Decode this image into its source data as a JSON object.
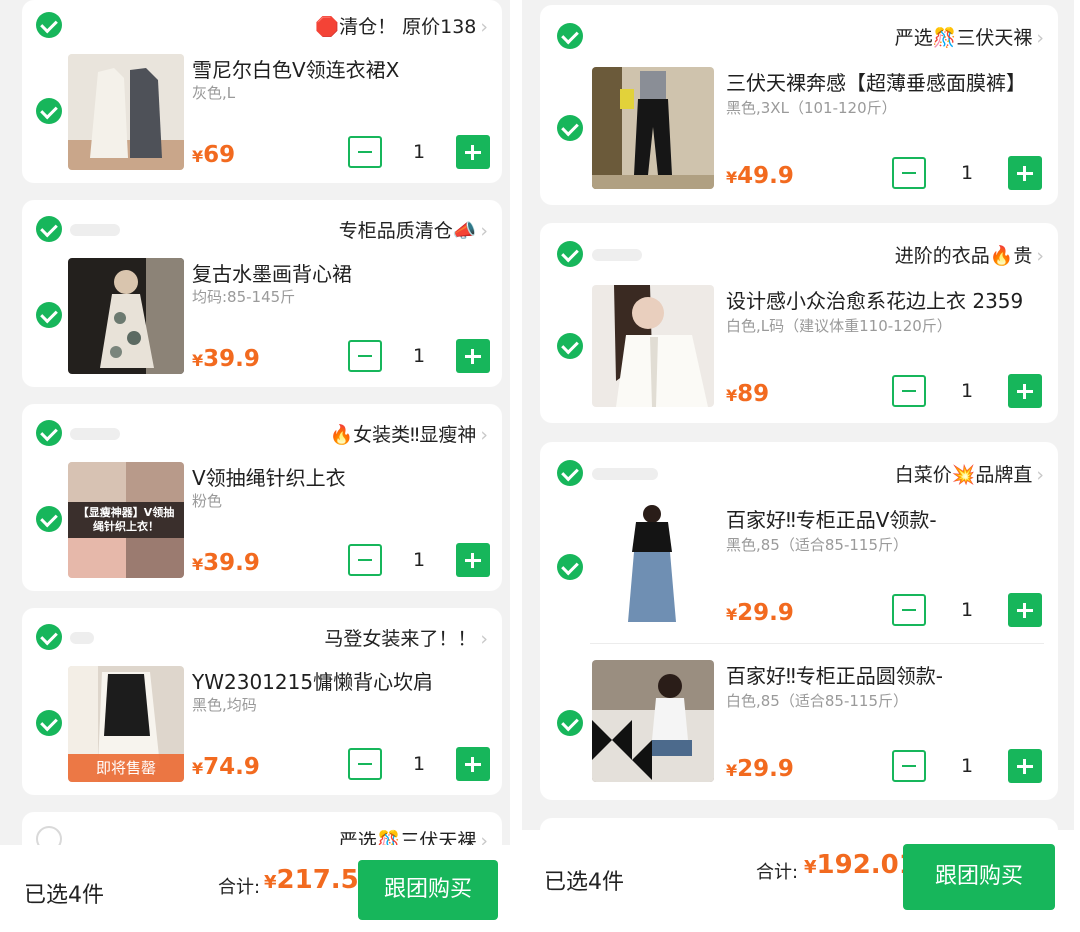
{
  "left": {
    "items": [
      {
        "shop": "🛑清仓！ 原价138",
        "title": "雪尼尔白色V领连衣裙X",
        "spec": "灰色,L",
        "price": "69",
        "qty": "1"
      },
      {
        "shop": "专柜品质清仓📣",
        "title": "复古水墨画背心裙",
        "spec": "均码:85-145斤",
        "price": "39.9",
        "qty": "1"
      },
      {
        "shop": "🔥女装类‼显瘦神",
        "title": "V领抽绳针织上衣",
        "spec": "粉色",
        "price": "39.9",
        "qty": "1",
        "thumb_text": "【显瘦神器】V领抽绳针织上衣！"
      },
      {
        "shop": "马登女装来了！！",
        "title": "YW2301215慵懒背心坎肩",
        "spec": "黑色,均码",
        "price": "74.9",
        "qty": "1",
        "badge": "即将售罄"
      }
    ],
    "peek_shop": "严选🎊三伏天裸",
    "footer": {
      "selected": "已选4件",
      "total_label": "合计:",
      "total": "217.57",
      "buy": "跟团购买"
    }
  },
  "right": {
    "shops": [
      {
        "shop": "严选🎊三伏天裸",
        "items": [
          {
            "title": "三伏天裸奔感【超薄垂感面膜裤】",
            "spec": "黑色,3XL（101-120斤）",
            "price": "49.9",
            "qty": "1"
          }
        ]
      },
      {
        "shop": "进阶的衣品🔥贵",
        "items": [
          {
            "title": "设计感小众治愈系花边上衣 2359",
            "spec": "白色,L码（建议体重110-120斤）",
            "price": "89",
            "qty": "1"
          }
        ]
      },
      {
        "shop": "白菜价💥品牌直",
        "items": [
          {
            "title": "百家好‼专柜正品V领款-",
            "spec": "黑色,85（适合85-115斤）",
            "price": "29.9",
            "qty": "1"
          },
          {
            "title": "百家好‼专柜正品圆领款-",
            "spec": "白色,85（适合85-115斤）",
            "price": "29.9",
            "qty": "1"
          }
        ]
      }
    ],
    "footer": {
      "selected": "已选4件",
      "total_label": "合计:",
      "total": "192.01",
      "buy": "跟团购买"
    }
  },
  "currency": "¥",
  "chevron": "›",
  "colors": {
    "accent_green": "#17b65b",
    "price_orange": "#f26a1f"
  }
}
